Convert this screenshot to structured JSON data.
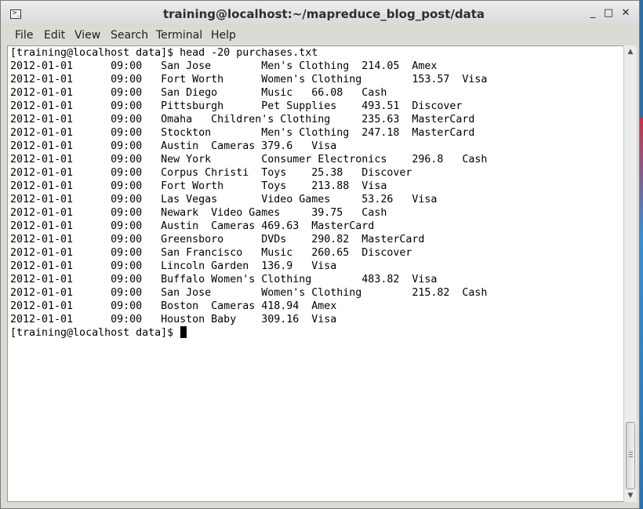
{
  "window": {
    "title": "training@localhost:~/mapreduce_blog_post/data",
    "minimize_glyph": "_",
    "maximize_glyph": "□",
    "close_glyph": "✕"
  },
  "menubar": {
    "items": [
      "File",
      "Edit",
      "View",
      "Search",
      "Terminal",
      "Help"
    ]
  },
  "terminal": {
    "lines": [
      "[training@localhost data]$ head -20 purchases.txt",
      "2012-01-01      09:00   San Jose        Men's Clothing  214.05  Amex",
      "2012-01-01      09:00   Fort Worth      Women's Clothing        153.57  Visa",
      "2012-01-01      09:00   San Diego       Music   66.08   Cash",
      "2012-01-01      09:00   Pittsburgh      Pet Supplies    493.51  Discover",
      "2012-01-01      09:00   Omaha   Children's Clothing     235.63  MasterCard",
      "2012-01-01      09:00   Stockton        Men's Clothing  247.18  MasterCard",
      "2012-01-01      09:00   Austin  Cameras 379.6   Visa",
      "2012-01-01      09:00   New York        Consumer Electronics    296.8   Cash",
      "2012-01-01      09:00   Corpus Christi  Toys    25.38   Discover",
      "2012-01-01      09:00   Fort Worth      Toys    213.88  Visa",
      "2012-01-01      09:00   Las Vegas       Video Games     53.26   Visa",
      "2012-01-01      09:00   Newark  Video Games     39.75   Cash",
      "2012-01-01      09:00   Austin  Cameras 469.63  MasterCard",
      "2012-01-01      09:00   Greensboro      DVDs    290.82  MasterCard",
      "2012-01-01      09:00   San Francisco   Music   260.65  Discover",
      "2012-01-01      09:00   Lincoln Garden  136.9   Visa",
      "2012-01-01      09:00   Buffalo Women's Clothing        483.82  Visa",
      "2012-01-01      09:00   San Jose        Women's Clothing        215.82  Cash",
      "2012-01-01      09:00   Boston  Cameras 418.94  Amex",
      "2012-01-01      09:00   Houston Baby    309.16  Visa"
    ],
    "prompt": "[training@localhost data]$ "
  },
  "icons": {
    "app": "terminal-icon",
    "scroll_up": "arrow-up-icon",
    "scroll_down": "arrow-down-icon"
  },
  "scroll_position": 1.0
}
